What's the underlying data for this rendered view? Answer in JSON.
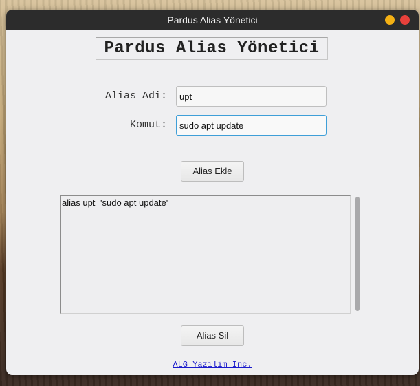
{
  "window": {
    "title": "Pardus Alias Yönetici"
  },
  "app": {
    "heading": "Pardus Alias Yönetici"
  },
  "form": {
    "alias_label": "Alias Adi:",
    "alias_value": "upt",
    "command_label": "Komut:",
    "command_value": "sudo apt update"
  },
  "buttons": {
    "add_label": "Alias Ekle",
    "remove_label": "Alias Sil"
  },
  "alias_list": {
    "items": [
      "alias upt='sudo apt update'"
    ]
  },
  "footer": {
    "link_text": "ALG Yazilim Inc."
  },
  "colors": {
    "titlebar": "#2c2c2c",
    "minimize_button": "#f4b114",
    "close_button": "#e8413b",
    "focus_border": "#3f9fd8",
    "link": "#1a1acc"
  }
}
